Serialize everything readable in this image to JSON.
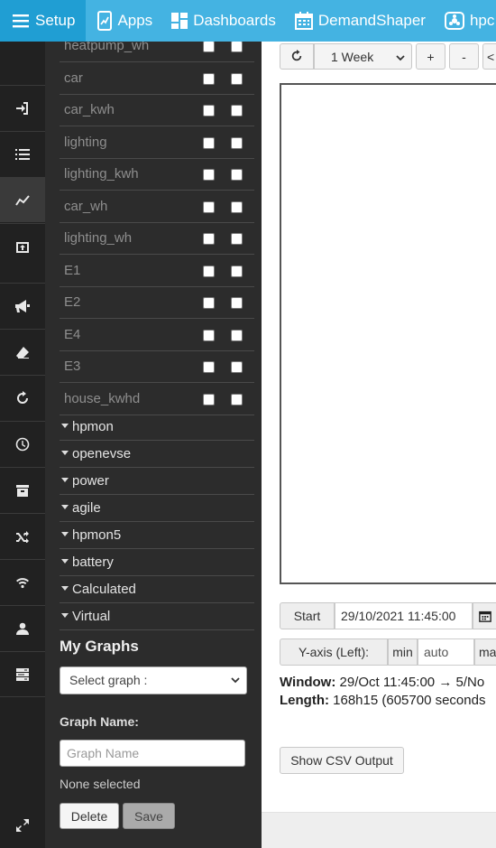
{
  "nav": {
    "items": [
      {
        "label": "Setup",
        "icon": "hamburger-icon"
      },
      {
        "label": "Apps",
        "icon": "phone-chart-icon"
      },
      {
        "label": "Dashboards",
        "icon": "dashboard-grid-icon"
      },
      {
        "label": "DemandShaper",
        "icon": "calendar-icon"
      },
      {
        "label": "hpc",
        "icon": "hpmon-icon"
      }
    ]
  },
  "feeds": [
    {
      "name": "heatpump_wh"
    },
    {
      "name": "car"
    },
    {
      "name": "car_kwh"
    },
    {
      "name": "lighting"
    },
    {
      "name": "lighting_kwh"
    },
    {
      "name": "car_wh"
    },
    {
      "name": "lighting_wh"
    },
    {
      "name": "E1"
    },
    {
      "name": "E2"
    },
    {
      "name": "E4"
    },
    {
      "name": "E3"
    },
    {
      "name": "house_kwhd"
    }
  ],
  "groups": [
    "hpmon",
    "openevse",
    "power",
    "agile",
    "hpmon5",
    "battery",
    "Calculated",
    "Virtual"
  ],
  "my_graphs": {
    "heading": "My Graphs",
    "select_placeholder": "Select graph :",
    "graph_name_label": "Graph Name:",
    "graph_name_placeholder": "Graph Name",
    "status": "None selected",
    "delete_label": "Delete",
    "save_label": "Save"
  },
  "toolbar": {
    "reload_icon": "reload-icon",
    "interval": "1 Week",
    "zoom_in": "+",
    "zoom_out": "-",
    "pan_left": "<"
  },
  "time": {
    "start_label": "Start",
    "start_value": "29/10/2021 11:45:00",
    "yaxis_label": "Y-axis (Left):",
    "min_label": "min",
    "min_value": "auto",
    "max_label": "ma"
  },
  "window_info": {
    "window_label": "Window:",
    "window_value": "29/Oct 11:45:00 → 5/No",
    "length_label": "Length:",
    "length_value": "168h15 (605700 seconds"
  },
  "csv_button": "Show CSV Output",
  "colors": {
    "nav_bg": "#44b3e2",
    "nav_active": "#209ed3",
    "iconbar": "#212121",
    "sidebar": "#2c2c2c"
  }
}
